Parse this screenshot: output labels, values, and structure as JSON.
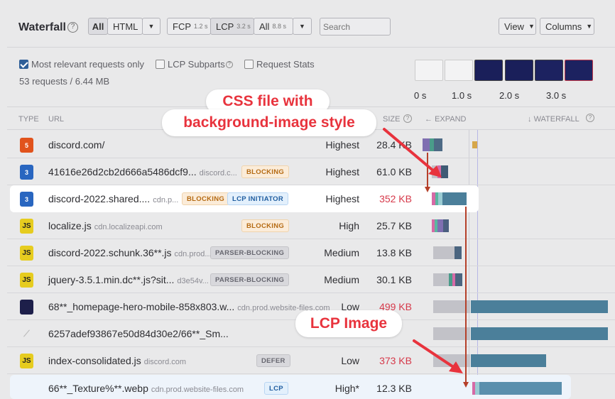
{
  "header": {
    "title": "Waterfall",
    "filter_all": "All",
    "filter_html": "HTML",
    "metric_fcp": "FCP",
    "metric_fcp_time": "1.2 s",
    "metric_lcp": "LCP",
    "metric_lcp_time": "3.2 s",
    "metric_all": "All",
    "metric_all_time": "8.8 s",
    "search_placeholder": "Search",
    "view_label": "View",
    "columns_label": "Columns"
  },
  "options": {
    "most_relevant": "Most relevant requests only",
    "lcp_subparts": "LCP Subparts",
    "request_stats": "Request Stats",
    "summary": "53 requests / 6.44 MB"
  },
  "timeline": {
    "t0": "0 s",
    "t1": "1.0 s",
    "t2": "2.0 s",
    "t3": "3.0 s"
  },
  "columns": {
    "type": "TYPE",
    "url": "URL",
    "size": "SIZE",
    "expand": "EXPAND",
    "waterfall": "WATERFALL"
  },
  "rows": [
    {
      "type": "html",
      "url": "discord.com/",
      "domain": "",
      "badges": [],
      "priority": "Highest",
      "size": "28.4 KB",
      "size_color": "#2e2e32"
    },
    {
      "type": "css",
      "url": "41616e26d2cb2d666a5486dcf9...",
      "domain": "discord.c...",
      "badges": [
        "BLOCKING"
      ],
      "priority": "Highest",
      "size": "61.0 KB",
      "size_color": "#2e2e32"
    },
    {
      "type": "css",
      "url": "discord-2022.shared....",
      "domain": "cdn.p...",
      "badges": [
        "BLOCKING",
        "LCP INITIATOR"
      ],
      "priority": "Highest",
      "size": "352 KB",
      "size_color": "#d6394a"
    },
    {
      "type": "js",
      "url": "localize.js",
      "domain": "cdn.localizeapi.com",
      "badges": [
        "BLOCKING"
      ],
      "priority": "High",
      "size": "25.7 KB",
      "size_color": "#2e2e32"
    },
    {
      "type": "js",
      "url": "discord-2022.schunk.36**.js",
      "domain": "cdn.prod...",
      "badges": [
        "PARSER-BLOCKING"
      ],
      "priority": "Medium",
      "size": "13.8 KB",
      "size_color": "#2e2e32"
    },
    {
      "type": "js",
      "url": "jquery-3.5.1.min.dc**.js?sit...",
      "domain": "d3e54v...",
      "badges": [
        "PARSER-BLOCKING"
      ],
      "priority": "Medium",
      "size": "30.1 KB",
      "size_color": "#2e2e32"
    },
    {
      "type": "img",
      "url": "68**_homepage-hero-mobile-858x803.w...",
      "domain": "cdn.prod.website-files.com",
      "badges": [],
      "priority": "Low",
      "size": "499 KB",
      "size_color": "#d6394a"
    },
    {
      "type": "img2",
      "url": "6257adef93867e50d84d30e2/66**_Sm...",
      "domain": "",
      "badges": [],
      "priority": "Low",
      "size": "",
      "size_color": "#2e2e32"
    },
    {
      "type": "js",
      "url": "index-consolidated.js",
      "domain": "discord.com",
      "badges": [
        "DEFER"
      ],
      "priority": "Low",
      "size": "373 KB",
      "size_color": "#d6394a"
    },
    {
      "type": "none",
      "url": "66**_Texture%**.webp",
      "domain": "cdn.prod.website-files.com",
      "badges": [
        "LCP"
      ],
      "priority": "High*",
      "size": "12.3 KB",
      "size_color": "#2e2e32"
    }
  ],
  "callouts": {
    "css_line1": "CSS file with",
    "css_line2": "background-image style",
    "lcp_image": "LCP Image"
  }
}
